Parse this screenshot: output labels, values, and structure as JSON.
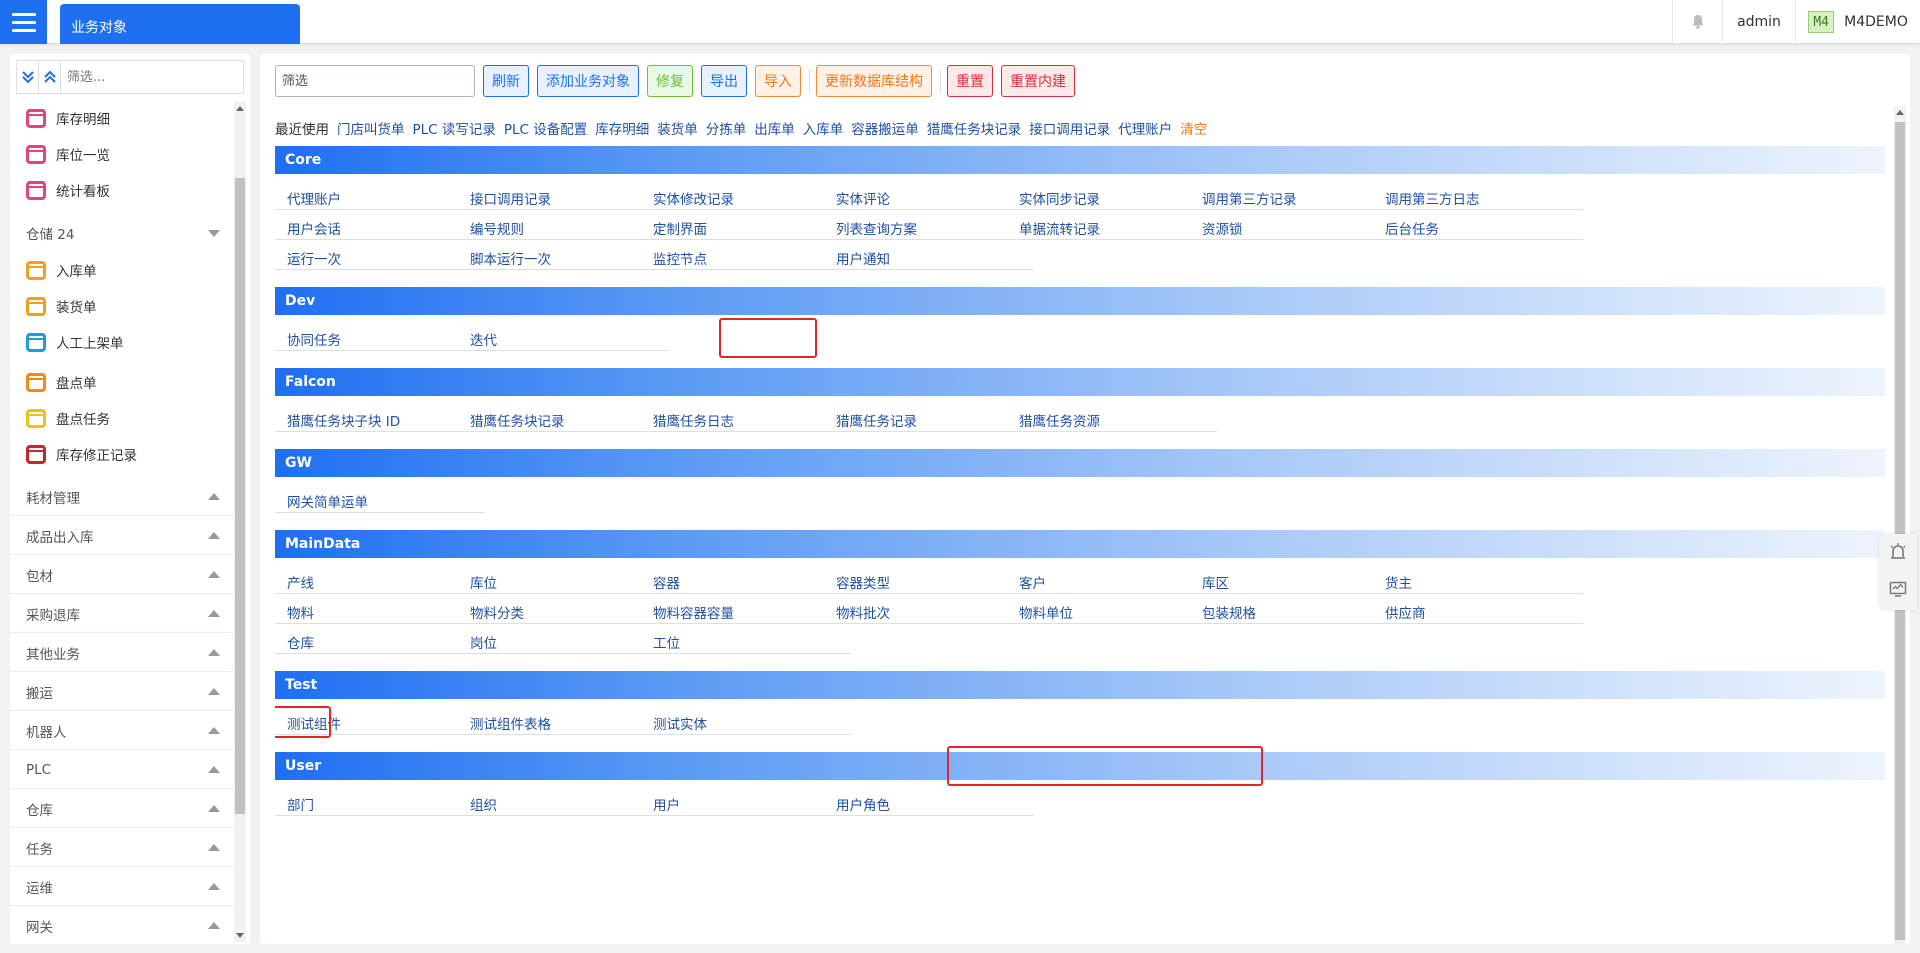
{
  "header": {
    "tab_title": "业务对象",
    "user": "admin",
    "tenant_badge": "M4",
    "tenant_name": "M4DEMO"
  },
  "sidebar": {
    "filter_placeholder": "筛选...",
    "items_top": [
      {
        "label": "库存明细",
        "color": "#e0457b"
      },
      {
        "label": "库位一览",
        "color": "#e0457b"
      },
      {
        "label": "统计看板",
        "color": "#e0457b"
      }
    ],
    "group_warehouse": "仓储 24",
    "items_warehouse": [
      {
        "label": "入库单",
        "color": "#f0a020"
      },
      {
        "label": "装货单",
        "color": "#f0a020"
      },
      {
        "label": "人工上架单",
        "color": "#1a9fd0"
      },
      {
        "label": "盘点单",
        "color": "#f08a10"
      },
      {
        "label": "盘点任务",
        "color": "#f0c020"
      },
      {
        "label": "库存修正记录",
        "color": "#c62828"
      }
    ],
    "groups": [
      "耗材管理",
      "成品出入库",
      "包材",
      "采购退库",
      "其他业务",
      "搬运",
      "机器人",
      "PLC",
      "仓库",
      "任务",
      "运维",
      "网关"
    ]
  },
  "toolbar": {
    "filter_placeholder": "筛选",
    "refresh": "刷新",
    "add": "添加业务对象",
    "repair": "修复",
    "export": "导出",
    "import": "导入",
    "update_db": "更新数据库结构",
    "reset": "重置",
    "reset_builtin": "重置内建"
  },
  "recent": {
    "label": "最近使用",
    "items": [
      "门店叫货单",
      "PLC 读写记录",
      "PLC 设备配置",
      "库存明细",
      "装货单",
      "分拣单",
      "出库单",
      "入库单",
      "容器搬运单",
      "猎鹰任务块记录",
      "接口调用记录",
      "代理账户"
    ],
    "clear": "清空"
  },
  "sections": [
    {
      "title": "Core",
      "links": [
        "代理账户",
        "接口调用记录",
        "实体修改记录",
        "实体评论",
        "实体同步记录",
        "调用第三方记录",
        "调用第三方日志",
        "用户会话",
        "编号规则",
        "定制界面",
        "列表查询方案",
        "单据流转记录",
        "资源锁",
        "后台任务",
        "运行一次",
        "脚本运行一次",
        "监控节点",
        "用户通知"
      ]
    },
    {
      "title": "Dev",
      "links": [
        "协同任务",
        "迭代"
      ]
    },
    {
      "title": "Falcon",
      "links": [
        "猎鹰任务块子块 ID",
        "猎鹰任务块记录",
        "猎鹰任务日志",
        "猎鹰任务记录",
        "猎鹰任务资源"
      ]
    },
    {
      "title": "GW",
      "links": [
        "网关简单运单"
      ]
    },
    {
      "title": "MainData",
      "links": [
        "产线",
        "库位",
        "容器",
        "容器类型",
        "客户",
        "库区",
        "货主",
        "物料",
        "物料分类",
        "物料容器容量",
        "物料批次",
        "物料单位",
        "包装规格",
        "供应商",
        "仓库",
        "岗位",
        "工位"
      ]
    },
    {
      "title": "Test",
      "links": [
        "测试组件",
        "测试组件表格",
        "测试实体"
      ]
    },
    {
      "title": "User",
      "links": [
        "部门",
        "组织",
        "用户",
        "用户角色"
      ]
    }
  ],
  "colors": {
    "accent": "#1e6ff1",
    "link": "#1f4fa5",
    "highlight": "#e4262a"
  }
}
